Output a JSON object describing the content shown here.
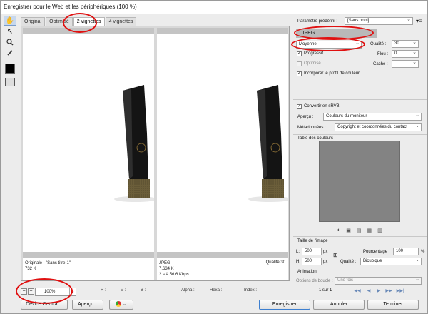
{
  "window": {
    "title": "Enregistrer pour le Web et les périphériques (100 %)"
  },
  "tools": [
    {
      "icon": "hand-icon",
      "glyph": "✋"
    },
    {
      "icon": "slice-select-icon",
      "glyph": "↖"
    },
    {
      "icon": "zoom-icon",
      "glyph": "🔍"
    },
    {
      "icon": "eyedropper-icon",
      "glyph": "✎"
    }
  ],
  "tabs": [
    "Original",
    "Optimisé",
    "2 vignettes",
    "4 vignettes"
  ],
  "panes": {
    "left": {
      "line1": "Originale : \"Sans titre-1\"",
      "line2": "732 K"
    },
    "right": {
      "line1": "JPEG",
      "line2": "7,634 K",
      "line3": "2 s à 56,6 Kbps",
      "quality": "Qualité 30"
    }
  },
  "status": {
    "zoom": "100%",
    "r": "R : --",
    "v": "V : --",
    "b": "B : --",
    "alpha": "Alpha : --",
    "hexa": "Hexa : --",
    "index": "Index : --"
  },
  "settings": {
    "preset_label": "Paramètre prédéfini :",
    "preset_value": "[Sans nom]",
    "format": "JPEG",
    "quality_preset": "Moyenne",
    "quality_label": "Qualité :",
    "quality_value": "30",
    "progressive": "Progressif",
    "blur_label": "Flou :",
    "blur_value": "0",
    "optimized": "Optimisé",
    "matte_label": "Cache :",
    "embed_profile": "Incorporer le profil de couleur",
    "convert_srgb": "Convertir en sRVB",
    "preview_label": "Aperçu :",
    "preview_value": "Couleurs du moniteur",
    "metadata_label": "Métadonnées :",
    "metadata_value": "Copyright et coordonnées du contact",
    "color_table_label": "Table des couleurs"
  },
  "image_size": {
    "title": "Taille de l'image",
    "w_label": "L:",
    "w_value": "500",
    "w_unit": "px",
    "h_label": "H:",
    "h_value": "500",
    "h_unit": "px",
    "percent_label": "Pourcentage :",
    "percent_value": "100",
    "percent_unit": "%",
    "quality_label": "Qualité :",
    "quality_value": "Bicubique"
  },
  "animation": {
    "title": "Animation",
    "loop_label": "Options de boucle :",
    "loop_value": "Une fois",
    "frame_text": "1 sur 1"
  },
  "buttons": {
    "device_central": "Device Central...",
    "preview": "Aperçu...",
    "save": "Enregistrer",
    "cancel": "Annuler",
    "done": "Terminer"
  },
  "colors": {
    "annotation": "#e01010",
    "colortable": "#838383"
  }
}
